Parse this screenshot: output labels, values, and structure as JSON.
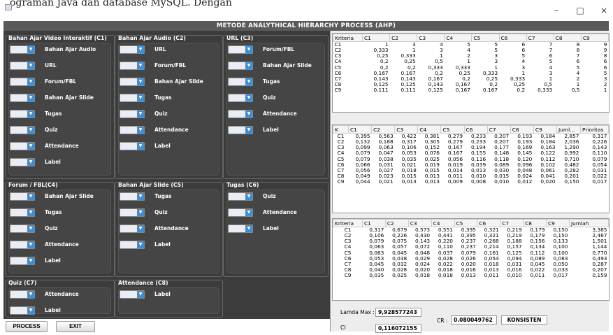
{
  "doc_text": "ograman Java dan database MySQL. Dengan",
  "window": {
    "minimize": "–",
    "maximize": "□",
    "close": "×"
  },
  "title": "METODE ANALYTHICAL HIERARCHY PROCESS (AHP)",
  "groups": [
    {
      "title": "Bahan Ajar Video Interaktif (C1)",
      "items": [
        "Bahan Ajar Audio",
        "URL",
        "Forum/FBL",
        "Bahan Ajar Slide",
        "Tugas",
        "Quiz",
        "Attendance",
        "Label"
      ]
    },
    {
      "title": "Bahan Ajar Audio (C2)",
      "items": [
        "URL",
        "Forum/FBL",
        "Bahan Ajar Slide",
        "Tugas",
        "Quiz",
        "Attendance",
        "Label"
      ]
    },
    {
      "title": "URL (C3)",
      "items": [
        "Forum/FBL",
        "Bahan Ajar Slide",
        "Tugas",
        "Quiz",
        "Attendance",
        "Label"
      ]
    },
    {
      "title": "Forum / FBL(C4)",
      "items": [
        "Bahan Ajar Slide",
        "Tugas",
        "Quiz",
        "Attendance",
        "Label"
      ]
    },
    {
      "title": "Bahan Ajar Slide (C5)",
      "items": [
        "Tugas",
        "Quiz",
        "Attendance",
        "Label"
      ]
    },
    {
      "title": "Tugas (C6)",
      "items": [
        "Quiz",
        "Attendance",
        "Label"
      ]
    },
    {
      "title": "Quiz (C7)",
      "items": [
        "Attendance",
        "Label"
      ]
    },
    {
      "title": "Attendance (C8)",
      "items": [
        "Label"
      ]
    }
  ],
  "buttons": {
    "process": "PROCESS",
    "exit": "EXIT"
  },
  "table1": {
    "headers": [
      "Kriteria",
      "C1",
      "C2",
      "C3",
      "C4",
      "C5",
      "C6",
      "C7",
      "C8",
      "C9"
    ],
    "rows": [
      [
        "C1",
        "1",
        "3",
        "4",
        "5",
        "5",
        "6",
        "7",
        "8",
        "9"
      ],
      [
        "C2",
        "0,333",
        "1",
        "3",
        "4",
        "5",
        "6",
        "7",
        "8",
        "9"
      ],
      [
        "C3",
        "0,25",
        "0,333",
        "1",
        "2",
        "3",
        "5",
        "6",
        "7",
        "8"
      ],
      [
        "C4",
        "0,2",
        "0,25",
        "0,5",
        "1",
        "3",
        "4",
        "5",
        "6",
        "6"
      ],
      [
        "C5",
        "0,2",
        "0,2",
        "0,333",
        "0,333",
        "1",
        "3",
        "4",
        "5",
        "6"
      ],
      [
        "C6",
        "0,167",
        "0,167",
        "0,2",
        "0,25",
        "0,333",
        "1",
        "3",
        "4",
        "5"
      ],
      [
        "C7",
        "0,143",
        "0,143",
        "0,167",
        "0,2",
        "0,25",
        "0,333",
        "1",
        "2",
        "3"
      ],
      [
        "C8",
        "0,125",
        "0,125",
        "0,143",
        "0,167",
        "0,2",
        "0,25",
        "0,5",
        "1",
        "2"
      ],
      [
        "C9",
        "0,111",
        "0,111",
        "0,125",
        "0,167",
        "0,167",
        "0,2",
        "0,333",
        "0,5",
        "1"
      ]
    ]
  },
  "table2": {
    "headers": [
      "K",
      "C1",
      "C2",
      "C3",
      "C4",
      "C5",
      "C6",
      "C7",
      "C8",
      "C9",
      "Juml...",
      "Prioritas"
    ],
    "rows": [
      [
        "C1",
        "0,395",
        "0,563",
        "0,422",
        "0,381",
        "0,279",
        "0,233",
        "0,207",
        "0,193",
        "0,184",
        "2,857",
        "0,317"
      ],
      [
        "C2",
        "0,132",
        "0,188",
        "0,317",
        "0,305",
        "0,279",
        "0,233",
        "0,207",
        "0,193",
        "0,184",
        "2,036",
        "0,226"
      ],
      [
        "C3",
        "0,099",
        "0,063",
        "0,106",
        "0,152",
        "0,167",
        "0,194",
        "0,177",
        "0,169",
        "0,163",
        "1,290",
        "0,143"
      ],
      [
        "C4",
        "0,079",
        "0,047",
        "0,053",
        "0,076",
        "0,167",
        "0,155",
        "0,148",
        "0,145",
        "0,122",
        "0,992",
        "0,110"
      ],
      [
        "C5",
        "0,079",
        "0,038",
        "0,035",
        "0,025",
        "0,056",
        "0,116",
        "0,118",
        "0,120",
        "0,112",
        "0,710",
        "0,079"
      ],
      [
        "C6",
        "0,066",
        "0,031",
        "0,021",
        "0,019",
        "0,019",
        "0,039",
        "0,089",
        "0,096",
        "0,102",
        "0,482",
        "0,054"
      ],
      [
        "C7",
        "0,056",
        "0,027",
        "0,018",
        "0,015",
        "0,014",
        "0,013",
        "0,030",
        "0,048",
        "0,061",
        "0,282",
        "0,031"
      ],
      [
        "C8",
        "0,049",
        "0,023",
        "0,015",
        "0,013",
        "0,011",
        "0,010",
        "0,015",
        "0,024",
        "0,041",
        "0,201",
        "0,022"
      ],
      [
        "C9",
        "0,044",
        "0,021",
        "0,013",
        "0,013",
        "0,009",
        "0,008",
        "0,010",
        "0,012",
        "0,020",
        "0,150",
        "0,017"
      ]
    ]
  },
  "table3": {
    "headers": [
      "Kriteria",
      "C1",
      "C2",
      "C3",
      "C4",
      "C5",
      "C6",
      "C7",
      "C8",
      "C9",
      "Jumlah"
    ],
    "rows": [
      [
        "C1",
        "0,317",
        "0,679",
        "0,573",
        "0,551",
        "0,395",
        "0,321",
        "0,219",
        "0,179",
        "0,150",
        "3,385"
      ],
      [
        "C2",
        "0,106",
        "0,226",
        "0,430",
        "0,441",
        "0,395",
        "0,321",
        "0,219",
        "0,179",
        "0,150",
        "2,467"
      ],
      [
        "C3",
        "0,079",
        "0,075",
        "0,143",
        "0,220",
        "0,237",
        "0,268",
        "0,188",
        "0,156",
        "0,133",
        "1,501"
      ],
      [
        "C4",
        "0,063",
        "0,057",
        "0,072",
        "0,110",
        "0,237",
        "0,214",
        "0,157",
        "0,134",
        "0,100",
        "1,144"
      ],
      [
        "C5",
        "0,063",
        "0,045",
        "0,048",
        "0,037",
        "0,079",
        "0,161",
        "0,125",
        "0,112",
        "0,100",
        "0,770"
      ],
      [
        "C6",
        "0,053",
        "0,038",
        "0,029",
        "0,028",
        "0,026",
        "0,054",
        "0,094",
        "0,089",
        "0,083",
        "0,493"
      ],
      [
        "C7",
        "0,045",
        "0,032",
        "0,024",
        "0,022",
        "0,020",
        "0,018",
        "0,031",
        "0,045",
        "0,050",
        "0,287"
      ],
      [
        "C8",
        "0,040",
        "0,028",
        "0,020",
        "0,018",
        "0,016",
        "0,013",
        "0,016",
        "0,022",
        "0,033",
        "0,207"
      ],
      [
        "C9",
        "0,035",
        "0,025",
        "0,018",
        "0,018",
        "0,013",
        "0,011",
        "0,010",
        "0,011",
        "0,017",
        "0,159"
      ]
    ]
  },
  "summary": {
    "lamda_label": "Lamda Max :",
    "lamda_value": "9,928577243",
    "ci_label": "CI",
    "ci_value": "0,116072155",
    "cr_label": "CR :",
    "cr_value": "0.080049762",
    "status": "KONSISTEN"
  },
  "colors": {
    "accent": "#3a8fd9",
    "panel": "#3c3c3c",
    "titlebar": "#5a5a5a"
  }
}
